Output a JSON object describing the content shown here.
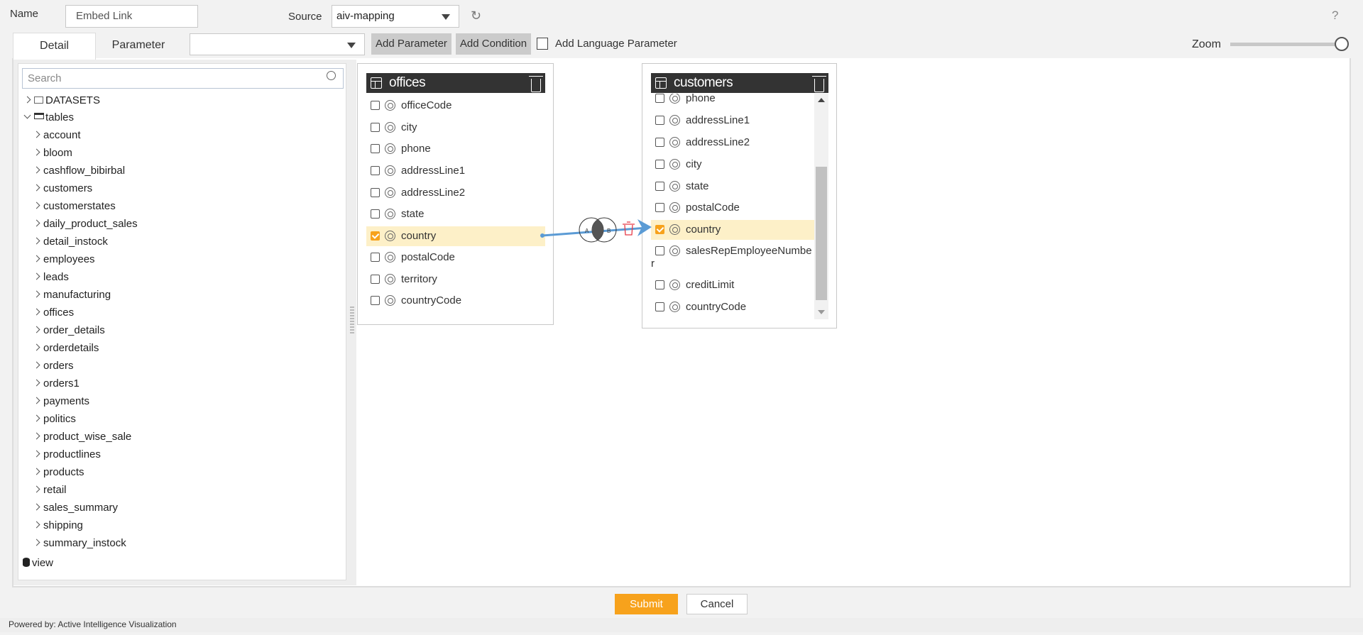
{
  "header": {
    "name_label": "Name",
    "name_value": "Embed Link",
    "source_label": "Source",
    "source_value": "aiv-mapping",
    "help": "?"
  },
  "tabs": [
    {
      "label": "Detail",
      "active": true
    },
    {
      "label": "Parameter",
      "active": false
    }
  ],
  "toolbar": {
    "parameter_select_value": "",
    "add_parameter": "Add Parameter",
    "add_condition": "Add Language Parameter",
    "add_condition_btn": "Add Condition",
    "language_checked": false,
    "zoom_label": "Zoom",
    "zoom_level": 1.0
  },
  "sidebar": {
    "search_placeholder": "Search",
    "datasets": "DATASETS",
    "tables": "tables",
    "table_items": [
      "account",
      "bloom",
      "cashflow_bibirbal",
      "customers",
      "customerstates",
      "daily_product_sales",
      "detail_instock",
      "employees",
      "leads",
      "manufacturing",
      "offices",
      "order_details",
      "orderdetails",
      "orders",
      "orders1",
      "payments",
      "politics",
      "product_wise_sale",
      "productlines",
      "products",
      "retail",
      "sales_summary",
      "shipping",
      "summary_instock"
    ],
    "view": "view"
  },
  "canvas": {
    "tables": [
      {
        "name": "offices",
        "fields": [
          {
            "name": "officeCode",
            "checked": false
          },
          {
            "name": "city",
            "checked": false
          },
          {
            "name": "phone",
            "checked": false
          },
          {
            "name": "addressLine1",
            "checked": false
          },
          {
            "name": "addressLine2",
            "checked": false
          },
          {
            "name": "state",
            "checked": false
          },
          {
            "name": "country",
            "checked": true
          },
          {
            "name": "postalCode",
            "checked": false
          },
          {
            "name": "territory",
            "checked": false
          },
          {
            "name": "countryCode",
            "checked": false
          }
        ]
      },
      {
        "name": "customers",
        "fields": [
          {
            "name": "phone",
            "checked": false
          },
          {
            "name": "addressLine1",
            "checked": false
          },
          {
            "name": "addressLine2",
            "checked": false
          },
          {
            "name": "city",
            "checked": false
          },
          {
            "name": "state",
            "checked": false
          },
          {
            "name": "postalCode",
            "checked": false
          },
          {
            "name": "country",
            "checked": true
          },
          {
            "name": "salesRepEmployeeNumber",
            "checked": false
          },
          {
            "name": "creditLimit",
            "checked": false
          },
          {
            "name": "countryCode",
            "checked": false
          }
        ]
      }
    ],
    "join": {
      "from": "offices.country",
      "to": "customers.country",
      "type": "inner",
      "venn_labels": [
        "A",
        "B"
      ],
      "line_color": "#5b9bd5"
    }
  },
  "footer": {
    "submit": "Submit",
    "cancel": "Cancel",
    "powered_by": "Powered by: Active Intelligence Visualization"
  },
  "colors": {
    "accent": "#f7a21c",
    "highlight": "#fdf0c8",
    "header_dark": "#333333"
  }
}
